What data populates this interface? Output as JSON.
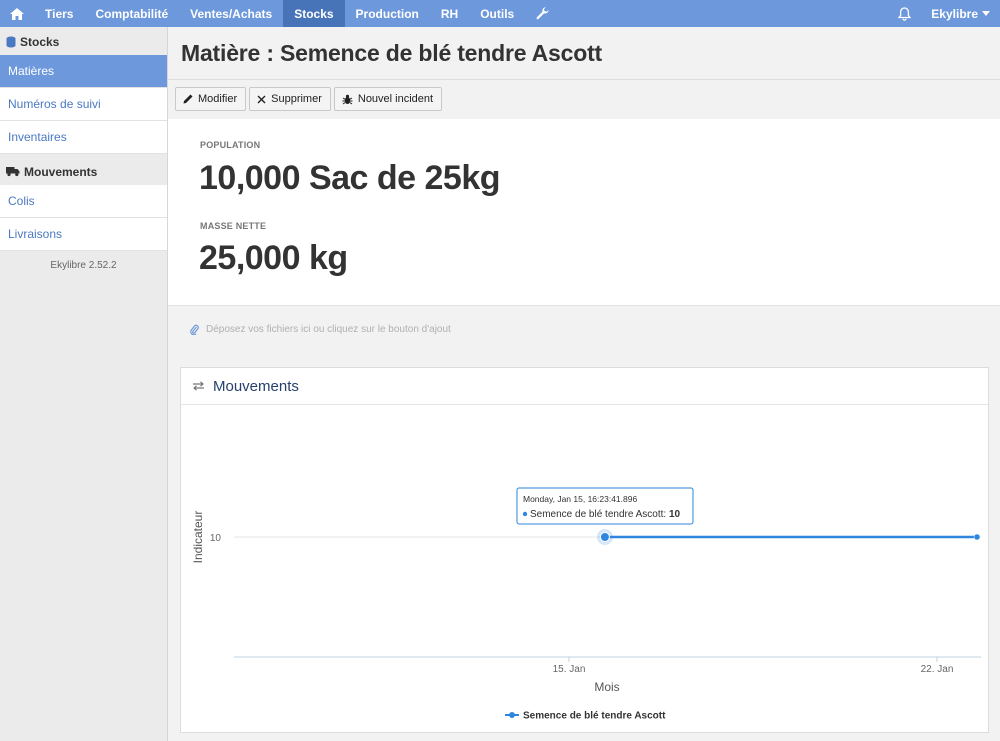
{
  "nav": {
    "items": [
      {
        "label": "Tiers",
        "active": false
      },
      {
        "label": "Comptabilité",
        "active": false
      },
      {
        "label": "Ventes/Achats",
        "active": false
      },
      {
        "label": "Stocks",
        "active": true
      },
      {
        "label": "Production",
        "active": false
      },
      {
        "label": "RH",
        "active": false
      },
      {
        "label": "Outils",
        "active": false
      }
    ],
    "user": "Ekylibre",
    "icons": {
      "home": "home-icon",
      "tool": "wrench-icon",
      "notifications": "bell-icon"
    }
  },
  "sidebar": {
    "stocks_title": "Stocks",
    "stocks_items": [
      {
        "label": "Matières",
        "active": true
      },
      {
        "label": "Numéros de suivi",
        "active": false
      },
      {
        "label": "Inventaires",
        "active": false
      }
    ],
    "movements_title": "Mouvements",
    "movements_items": [
      {
        "label": "Colis"
      },
      {
        "label": "Livraisons"
      }
    ],
    "version": "Ekylibre 2.52.2"
  },
  "page": {
    "title": "Matière : Semence de blé tendre Ascott",
    "toolbar": {
      "edit": "Modifier",
      "delete": "Supprimer",
      "incident": "Nouvel incident"
    },
    "indicators": {
      "population_label": "POPULATION",
      "population_value": "10,000 Sac de 25kg",
      "net_mass_label": "MASSE NETTE",
      "net_mass_value": "25,000 kg"
    },
    "dropzone": "Déposez vos fichiers ici ou cliquez sur le bouton d'ajout",
    "chart_card_title": "Mouvements"
  },
  "colors": {
    "nav": "#6d98dc",
    "nav_active": "#4774b9",
    "link": "#4b79c1",
    "series": "#2e86de"
  },
  "chart_data": {
    "type": "line",
    "xlabel": "Mois",
    "ylabel": "Indicateur",
    "x_ticks": [
      "15. Jan",
      "22. Jan"
    ],
    "y_ticks": [
      10
    ],
    "series": [
      {
        "name": "Semence de blé tendre Ascott",
        "points": [
          {
            "x": "2018-01-15T16:23:41",
            "y": 10
          },
          {
            "x": "2018-01-24",
            "y": 10
          }
        ]
      }
    ],
    "tooltip": {
      "date": "Monday, Jan 15, 16:23:41.896",
      "series": "Semence de blé tendre Ascott",
      "value": "10"
    },
    "legend_position": "bottom-center"
  }
}
